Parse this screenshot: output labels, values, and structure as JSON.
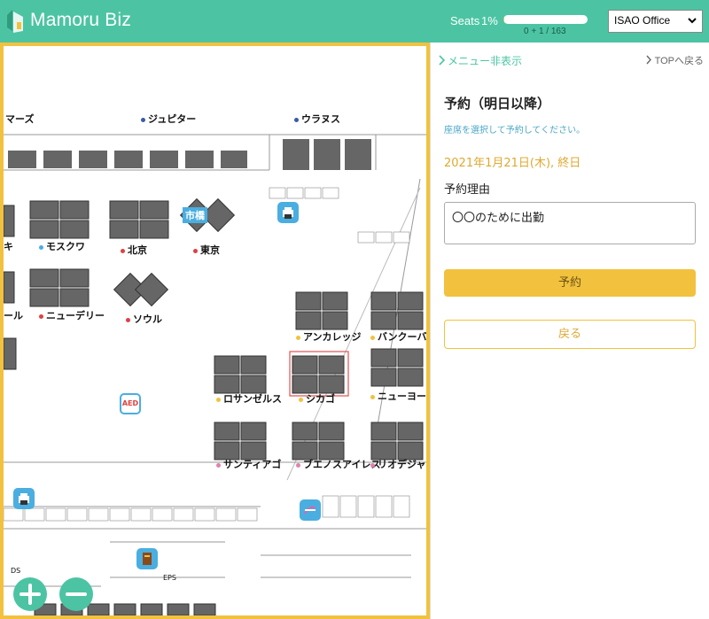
{
  "header": {
    "brand": "Mamoru Biz",
    "seats_label": "Seats",
    "seats_percent": "1%",
    "seats_fill_fraction": 0.01,
    "seats_count": "0 + 1 / 163",
    "office_selected": "ISAO Office",
    "accent_color": "#4cc4a3"
  },
  "map": {
    "labels": {
      "mars": "マーズ",
      "jupiter": "ジュピター",
      "uranus": "ウラヌス",
      "moscow": "モスクワ",
      "beijing": "北京",
      "tokyo": "東京",
      "ichibashi": "市橋",
      "newdelhi": "ニューデリー",
      "seoul": "ソウル",
      "anchorage": "アンカレッジ",
      "vancouver": "バンクーバー",
      "losangeles": "ロサンゼルス",
      "chicago": "シカゴ",
      "newyork": "ニューヨーク",
      "santiago": "サンティアゴ",
      "buenosaires": "ブエノスアイレス",
      "riodejaneiro": "リオデジャネイロ",
      "aed": "AED",
      "ki": "キ",
      "ru": "ール",
      "eps": "EPS",
      "ds": "DS"
    },
    "zoom_in_icon": "plus-icon",
    "zoom_out_icon": "minus-icon"
  },
  "panel": {
    "hide_menu": "メニュー非表示",
    "top_link": "TOPへ戻る",
    "title": "予約（明日以降）",
    "hint": "座席を選択して予約してください。",
    "date": "2021年1月21日(木), 終日",
    "reason_label": "予約理由",
    "reason_value": "〇〇のために出勤",
    "reserve_button": "予約",
    "back_button": "戻る"
  }
}
